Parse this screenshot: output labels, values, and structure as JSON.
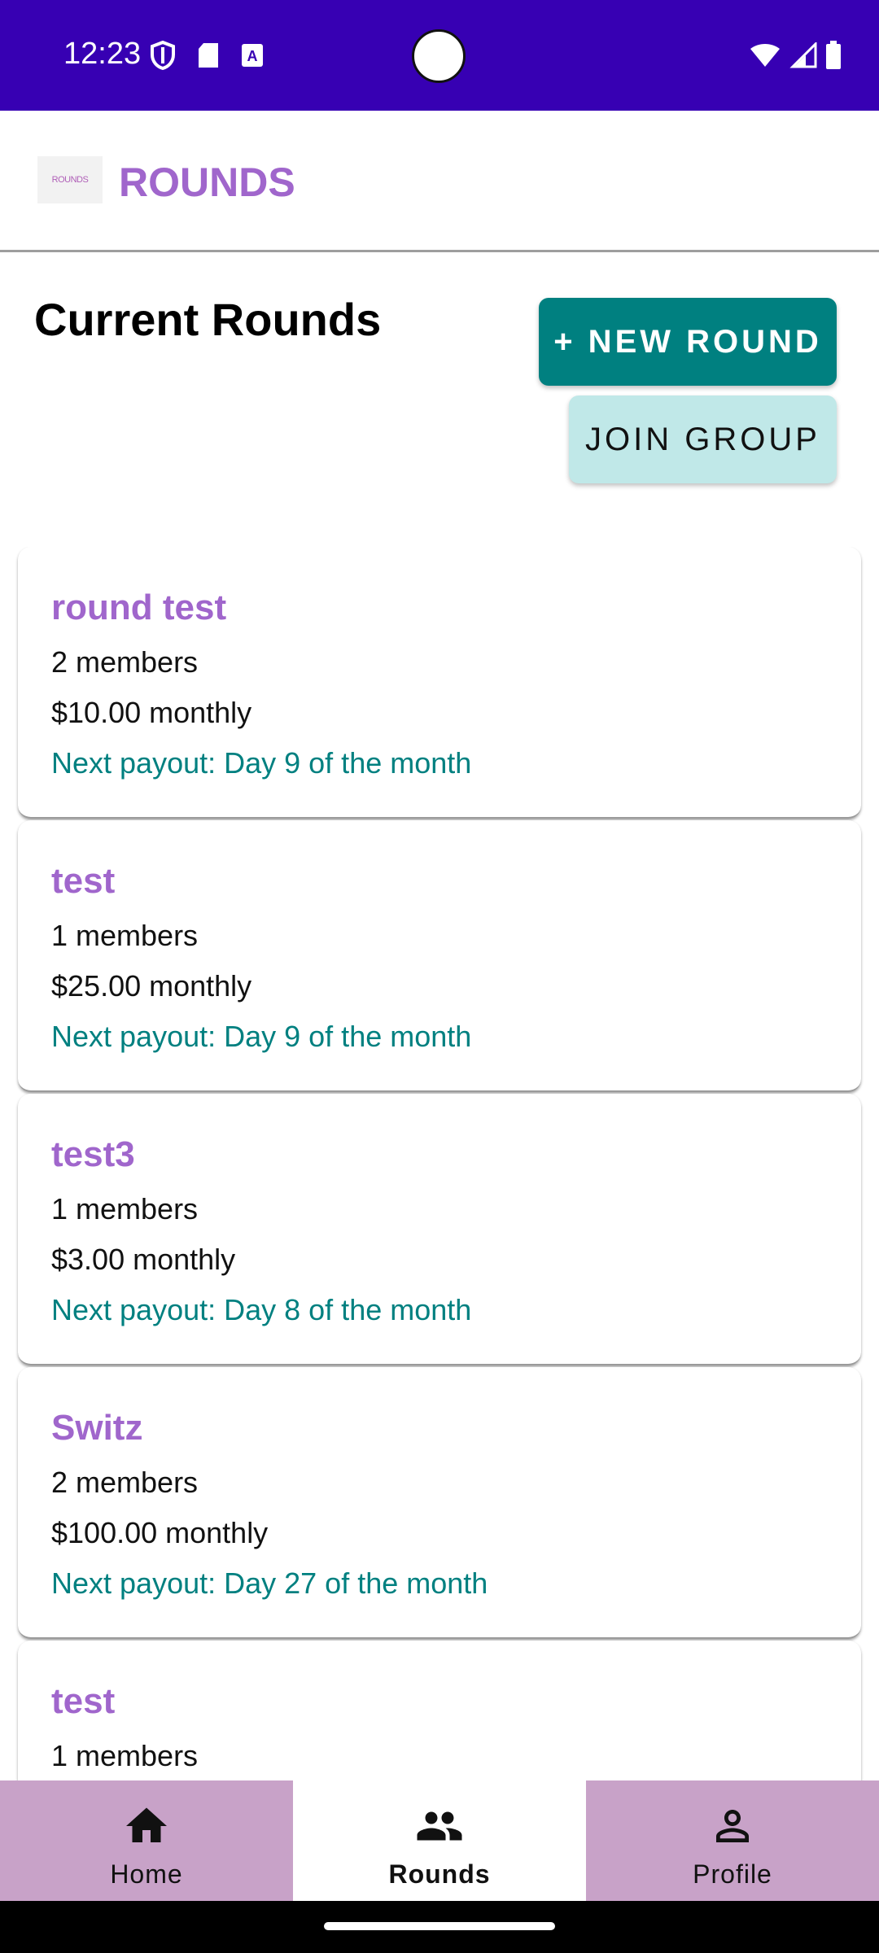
{
  "status_bar": {
    "time": "12:23",
    "icons_left": [
      "shield-icon",
      "sd-card-icon",
      "font-a-icon"
    ],
    "icons_right": [
      "wifi-icon",
      "signal-icon",
      "battery-icon"
    ]
  },
  "app_bar": {
    "logo_text": "ROUNDS",
    "title": "ROUNDS"
  },
  "page": {
    "title": "Current Rounds",
    "new_round_label": "+ NEW ROUND",
    "join_group_label": "JOIN GROUP"
  },
  "rounds": [
    {
      "name": "round test",
      "members": "2 members",
      "amount": "$10.00 monthly",
      "payout": "Next payout: Day 9 of the month"
    },
    {
      "name": "test",
      "members": "1 members",
      "amount": "$25.00 monthly",
      "payout": "Next payout: Day 9 of the month"
    },
    {
      "name": "test3",
      "members": "1 members",
      "amount": "$3.00 monthly",
      "payout": "Next payout: Day 8 of the month"
    },
    {
      "name": "Switz",
      "members": "2 members",
      "amount": "$100.00 monthly",
      "payout": "Next payout: Day 27 of the month"
    },
    {
      "name": "test",
      "members": "1 members",
      "amount": "",
      "payout": ""
    }
  ],
  "bottom_nav": {
    "items": [
      {
        "label": "Home",
        "icon": "home-icon",
        "active": false
      },
      {
        "label": "Rounds",
        "icon": "group-icon",
        "active": true
      },
      {
        "label": "Profile",
        "icon": "person-icon",
        "active": false
      }
    ]
  },
  "colors": {
    "status_bar": "#3700b3",
    "brand_purple": "#a066cc",
    "teal": "#008080",
    "join_bg": "#c0e8e8",
    "nav_bg": "#c8a2c8"
  }
}
